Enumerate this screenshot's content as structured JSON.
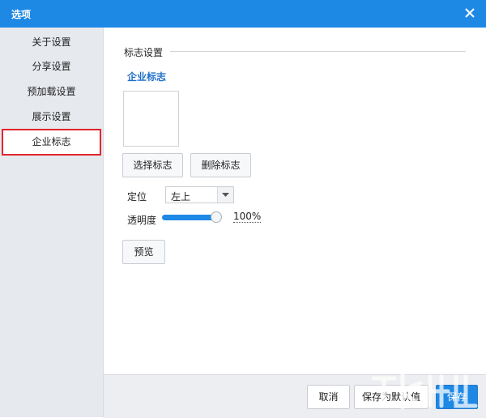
{
  "window": {
    "title": "选项",
    "close_icon": "close-icon"
  },
  "sidebar": {
    "items": [
      {
        "label": "关于设置",
        "active": false
      },
      {
        "label": "分享设置",
        "active": false
      },
      {
        "label": "预加载设置",
        "active": false
      },
      {
        "label": "展示设置",
        "active": false
      },
      {
        "label": "企业标志",
        "active": true
      }
    ]
  },
  "main": {
    "section_title": "标志设置",
    "logo_heading": "企业标志",
    "select_logo_label": "选择标志",
    "delete_logo_label": "删除标志",
    "position_label": "定位",
    "position_value": "左上",
    "opacity_label": "透明度",
    "opacity_text": "100%",
    "opacity_value": 1.0,
    "preview_label": "预览"
  },
  "footer": {
    "cancel_label": "取消",
    "save_default_label": "保存为默认值",
    "save_label": "保存"
  },
  "colors": {
    "accent": "#1e88e5",
    "sidebar_bg": "#e6e9ee",
    "active_border": "#e0252c",
    "heading_blue": "#1e6fc8"
  }
}
